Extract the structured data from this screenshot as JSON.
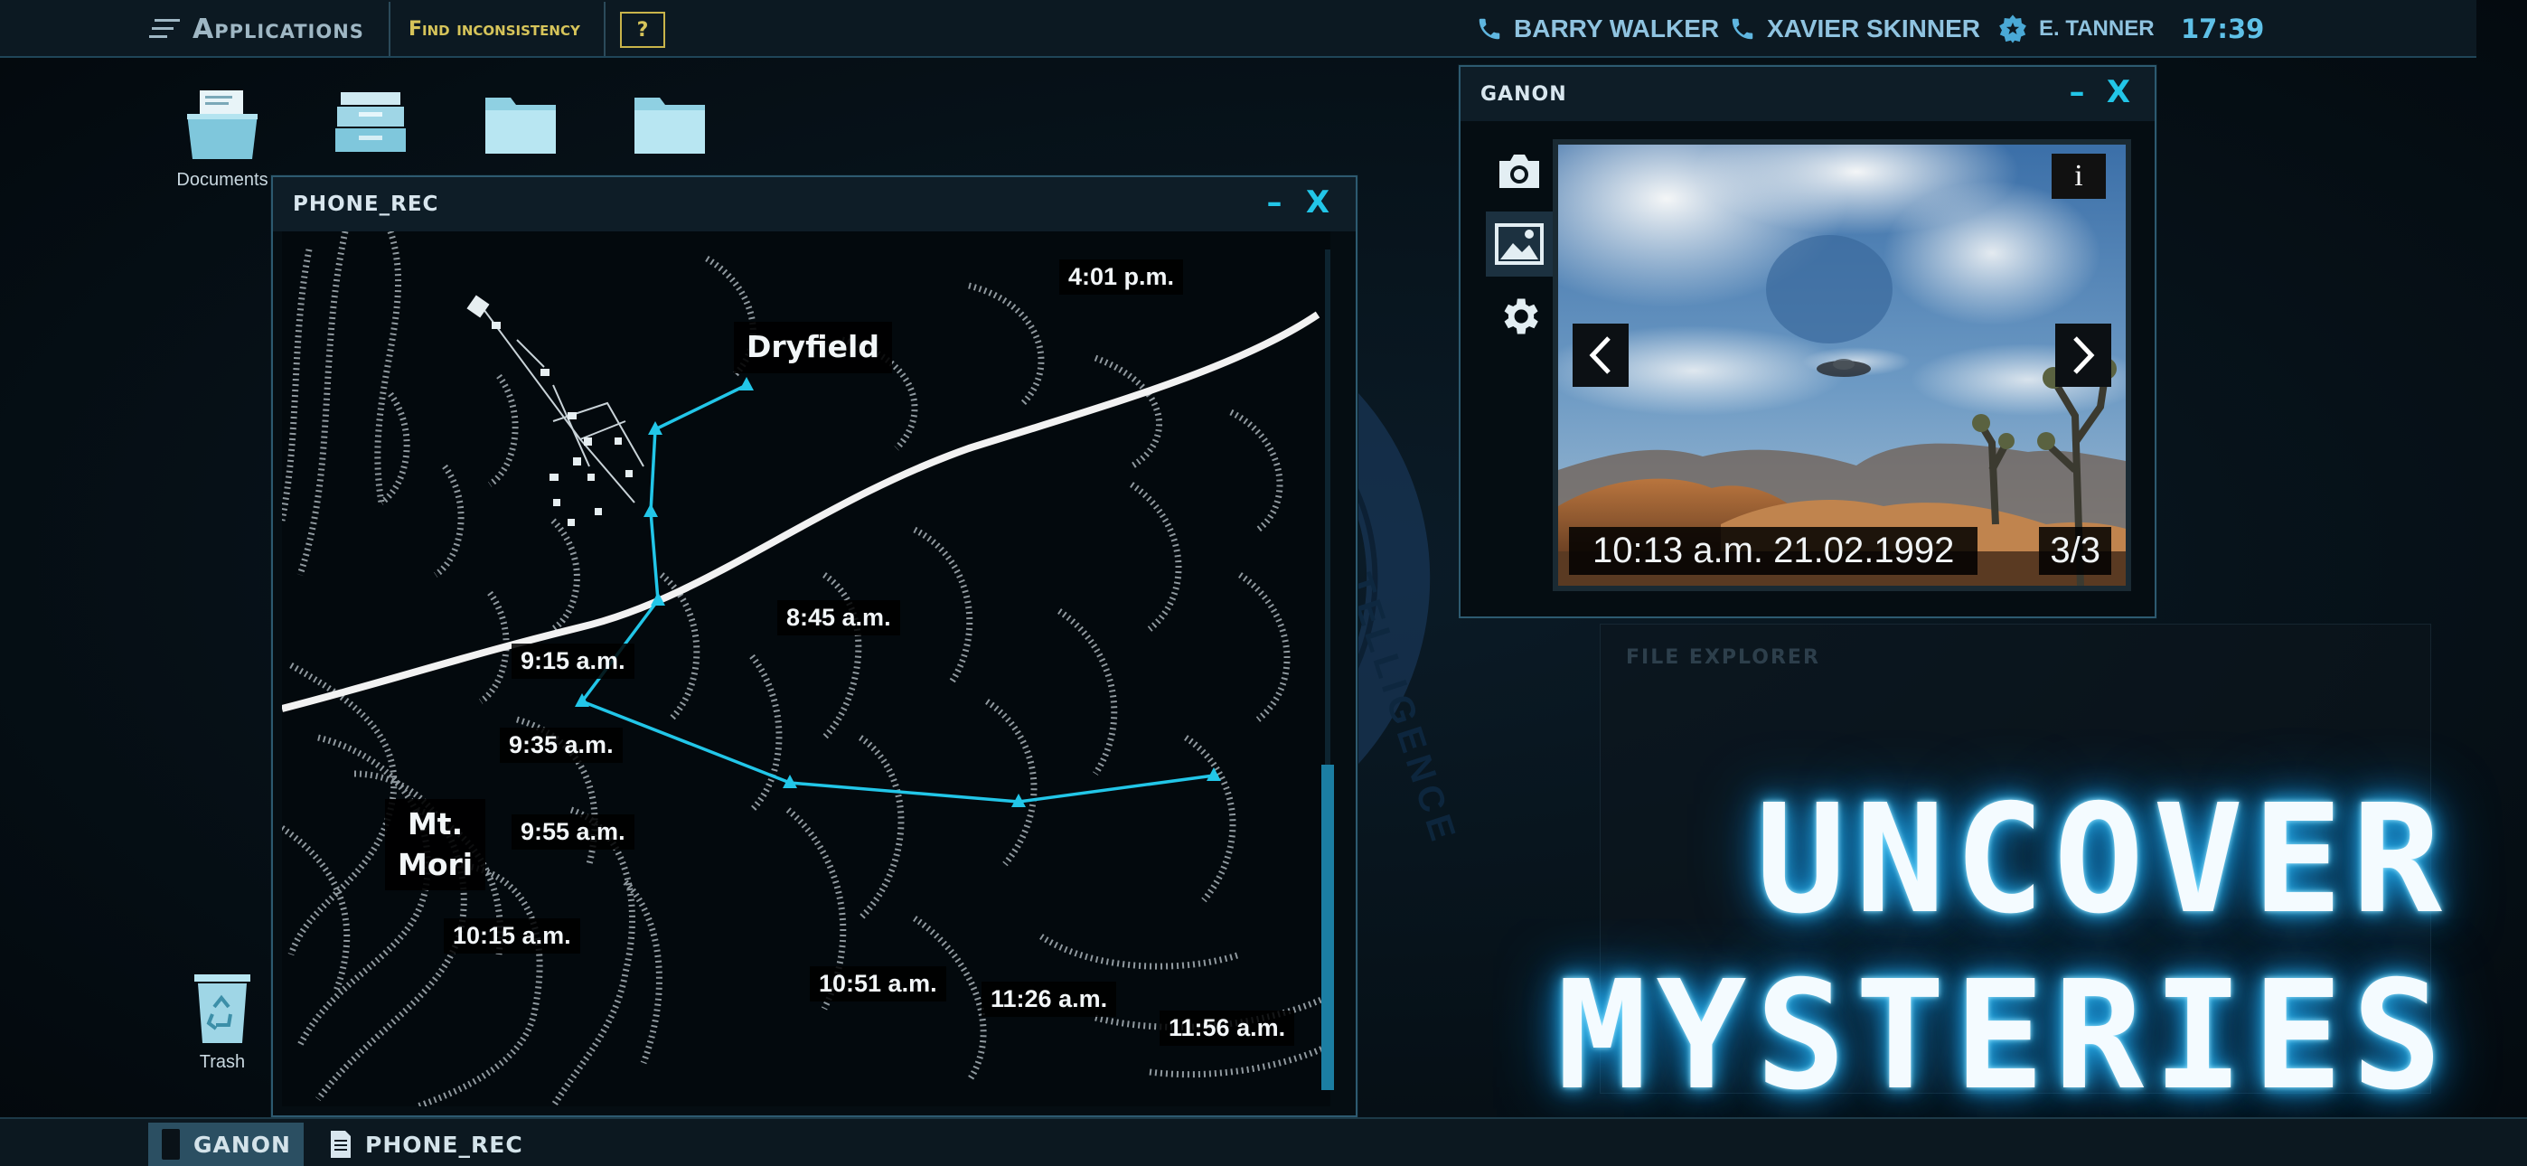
{
  "topbar": {
    "applications_label": "Applications",
    "find_label": "Find inconsistency",
    "help_label": "?",
    "users": [
      {
        "name": "BARRY WALKER",
        "icon": "phone-icon"
      },
      {
        "name": "XAVIER SKINNER",
        "icon": "phone-icon"
      },
      {
        "name": "E. TANNER",
        "icon": "badge-icon"
      }
    ],
    "clock": "17:39"
  },
  "desktop": {
    "icons": [
      {
        "label": "Documents",
        "icon": "documents-folder-icon"
      },
      {
        "label": "",
        "icon": "archive-tray-icon"
      },
      {
        "label": "",
        "icon": "folder-icon"
      },
      {
        "label": "",
        "icon": "folder-icon"
      }
    ],
    "trash_label": "Trash"
  },
  "phone_rec": {
    "title": "PHONE_REC",
    "minimize": "–",
    "close": "X",
    "places": {
      "town": "Dryfield",
      "mountain_line1": "Mt.",
      "mountain_line2": "Mori"
    },
    "waypoints": [
      {
        "time": "4:01 p.m.",
        "color": "#1fd96a"
      },
      {
        "time": "8:45 a.m.",
        "color": "#22c6e8"
      },
      {
        "time": "9:15 a.m.",
        "color": "#22c6e8"
      },
      {
        "time": "9:35 a.m.",
        "color": "#22c6e8"
      },
      {
        "time": "9:55 a.m.",
        "color": "#22c6e8"
      },
      {
        "time": "10:15 a.m.",
        "color": "#22c6e8"
      },
      {
        "time": "10:51 a.m.",
        "color": "#22c6e8"
      },
      {
        "time": "11:26 a.m.",
        "color": "#22c6e8"
      },
      {
        "time": "11:56 a.m.",
        "color": "#22c6e8"
      }
    ]
  },
  "ganon": {
    "title": "GANON",
    "minimize": "–",
    "close": "X",
    "sidebar": [
      {
        "icon": "camera-icon"
      },
      {
        "icon": "gallery-icon",
        "active": true
      },
      {
        "icon": "settings-gear-icon"
      }
    ],
    "photo": {
      "info": "i",
      "timestamp": "10:13 a.m. 21.02.1992",
      "counter": "3/3"
    }
  },
  "background": {
    "window_title": "FILE EXPLORER"
  },
  "taskbar": {
    "items": [
      {
        "label": "GANON",
        "active": true
      },
      {
        "label": "PHONE_REC",
        "active": false
      }
    ]
  },
  "promo": {
    "line1": "UNCOVER",
    "line2": "MYSTERIES"
  },
  "colors": {
    "accent": "#22c6e8",
    "find_yellow": "#d6c45a",
    "glow": "#2fb8f0"
  }
}
